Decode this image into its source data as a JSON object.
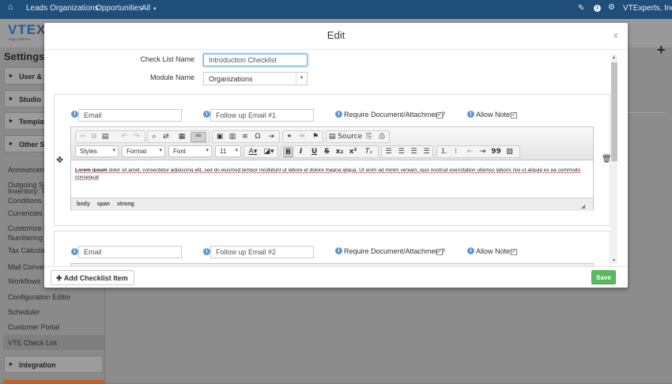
{
  "topbar": {
    "nav": [
      "Leads",
      "Organizations",
      "Opportunities",
      "All"
    ],
    "user": "VTExperts, Inc."
  },
  "brand": {
    "logo_a": "VTE",
    "logo_b": "X",
    "tagline": "vTiger CRM Ext"
  },
  "sidebar": {
    "title": "Settings",
    "sections": [
      "User & Ac",
      "Studio",
      "Templates",
      "Other Set",
      "Integration"
    ],
    "items": [
      "Announceme",
      "Outgoing Serv",
      "Inventory: Ter Conditions",
      "Currencies",
      "Customize Re Numbering",
      "Tax Calculatio",
      "Mail Converte",
      "Workflows",
      "Configuration Editor",
      "Scheduler",
      "Customer Portal",
      "VTE Check List"
    ]
  },
  "modal": {
    "title": "Edit",
    "close": "x",
    "checklist_name_label": "Check List Name",
    "checklist_name_value": "Introduction Checklist",
    "module_name_label": "Module Name",
    "module_name_value": "Organizations",
    "items": [
      {
        "type": "Email",
        "subject": "Follow up Email #1",
        "require_label": "Require Document/Attachment?",
        "allow_label": "Allow Notes"
      },
      {
        "type": "Email",
        "subject": "Follow up Email #2",
        "require_label": "Require Document/Attachment?",
        "allow_label": "Allow Notes"
      }
    ],
    "editor": {
      "styles": "Styles",
      "format": "Format",
      "font": "Font",
      "size": "11",
      "source": "Source",
      "content_bold": "Lorem ipsum",
      "content": " dolor sit amet, consectetur adipiscing elit, sed do eiusmod tempor incididunt ut labore et dolore magna aliqua. Ut enim ad minim veniam, quis nostrud exercitation ullamco laboris nisi ut aliquip ex ea commodo consequat",
      "path": [
        "body",
        "span",
        "strong"
      ]
    },
    "add_button": "Add Checklist Item",
    "save_button": "Save"
  }
}
